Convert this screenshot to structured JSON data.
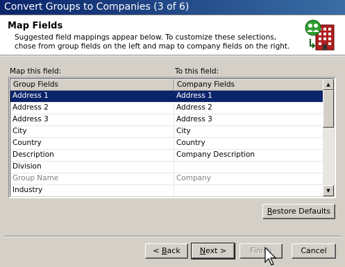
{
  "window": {
    "title": "Convert Groups to Companies (3 of 6)"
  },
  "header": {
    "title": "Map Fields",
    "description": "Suggested field mappings appear below.  To customize these selections, chose from group fields on the left and map to company fields on the right.",
    "icon": "groups-to-company-icon"
  },
  "labels": {
    "left": "Map this field:",
    "right": "To this field:"
  },
  "grid": {
    "columns": [
      "Group Fields",
      "Company Fields"
    ],
    "rows": [
      {
        "group": "Address 1",
        "company": "Address 1",
        "state": "selected"
      },
      {
        "group": "Address 2",
        "company": "Address 2",
        "state": "normal"
      },
      {
        "group": "Address 3",
        "company": "Address 3",
        "state": "normal"
      },
      {
        "group": "City",
        "company": "City",
        "state": "normal"
      },
      {
        "group": "Country",
        "company": "Country",
        "state": "normal"
      },
      {
        "group": "Description",
        "company": "Company Description",
        "state": "normal"
      },
      {
        "group": "Division",
        "company": "",
        "state": "normal"
      },
      {
        "group": "Group Name",
        "company": "Company",
        "state": "disabled"
      },
      {
        "group": "Industry",
        "company": "",
        "state": "normal"
      }
    ]
  },
  "buttons": {
    "restore_pre": "",
    "restore_u": "R",
    "restore_post": "estore Defaults",
    "back_pre": "< ",
    "back_u": "B",
    "back_post": "ack",
    "next_pre": "",
    "next_u": "N",
    "next_post": "ext >",
    "finish": "Finish",
    "cancel": "Cancel"
  },
  "colors": {
    "titlebar": "#0a246a",
    "selection": "#0a246a",
    "face": "#d4d0c8"
  }
}
